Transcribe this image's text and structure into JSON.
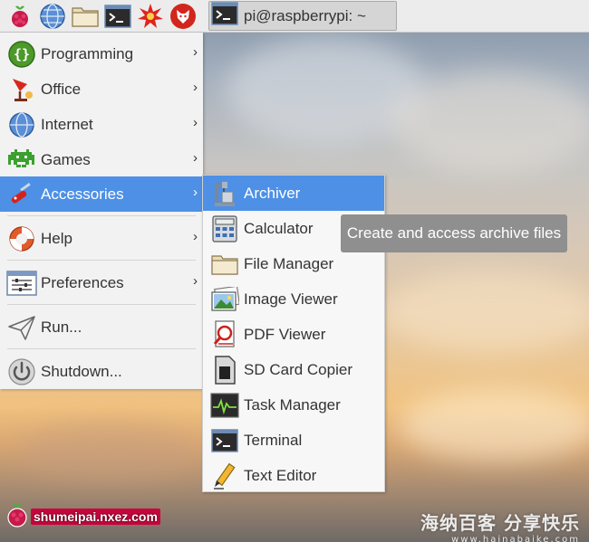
{
  "taskbar": {
    "icons": [
      "raspberry-menu-icon",
      "web-browser-icon",
      "file-manager-icon",
      "terminal-icon",
      "wolfram-icon",
      "mathematica-icon"
    ],
    "task_label": "pi@raspberrypi: ~"
  },
  "main_menu": {
    "items": [
      {
        "label": "Programming",
        "icon": "programming-icon",
        "submenu": true
      },
      {
        "label": "Office",
        "icon": "office-icon",
        "submenu": true
      },
      {
        "label": "Internet",
        "icon": "internet-icon",
        "submenu": true
      },
      {
        "label": "Games",
        "icon": "games-icon",
        "submenu": true
      },
      {
        "label": "Accessories",
        "icon": "accessories-icon",
        "submenu": true,
        "selected": true
      },
      {
        "label": "Help",
        "icon": "help-icon",
        "submenu": true
      },
      {
        "label": "Preferences",
        "icon": "preferences-icon",
        "submenu": true
      },
      {
        "label": "Run...",
        "icon": "run-icon",
        "submenu": false
      },
      {
        "label": "Shutdown...",
        "icon": "shutdown-icon",
        "submenu": false
      }
    ],
    "arrow": "›"
  },
  "accessories_menu": {
    "items": [
      {
        "label": "Archiver",
        "icon": "archiver-icon",
        "selected": true
      },
      {
        "label": "Calculator",
        "icon": "calculator-icon"
      },
      {
        "label": "File Manager",
        "icon": "folder-icon"
      },
      {
        "label": "Image Viewer",
        "icon": "image-viewer-icon"
      },
      {
        "label": "PDF Viewer",
        "icon": "pdf-viewer-icon"
      },
      {
        "label": "SD Card Copier",
        "icon": "sd-card-icon"
      },
      {
        "label": "Task Manager",
        "icon": "task-manager-icon"
      },
      {
        "label": "Terminal",
        "icon": "terminal-icon"
      },
      {
        "label": "Text Editor",
        "icon": "text-editor-icon"
      }
    ]
  },
  "tooltip": {
    "text": "Create and access archive files"
  },
  "watermarks": {
    "left_text": "shumeipai.nxez.com",
    "right_text": "海纳百客 分享快乐",
    "right_url": "www.hainabaike.com"
  },
  "colors": {
    "selection": "#4d90e6",
    "menu_bg": "#f2f2f2",
    "tooltip_bg": "#8f8f8f"
  }
}
